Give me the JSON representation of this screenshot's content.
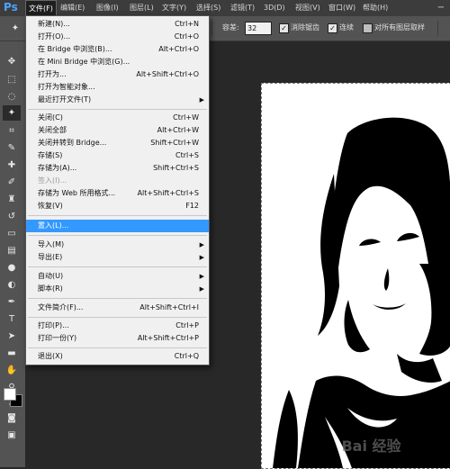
{
  "app": {
    "logo": "Ps"
  },
  "menubar": {
    "items": [
      {
        "label": "文件(F)"
      },
      {
        "label": "编辑(E)"
      },
      {
        "label": "图像(I)"
      },
      {
        "label": "图层(L)"
      },
      {
        "label": "文字(Y)"
      },
      {
        "label": "选择(S)"
      },
      {
        "label": "滤镜(T)"
      },
      {
        "label": "3D(D)"
      },
      {
        "label": "视图(V)"
      },
      {
        "label": "窗口(W)"
      },
      {
        "label": "帮助(H)"
      }
    ]
  },
  "options": {
    "tolerance_label": "容差:",
    "tolerance_value": "32",
    "antialias_label": "消除锯齿",
    "contiguous_label": "连续",
    "sample_all_label": "对所有图层取样"
  },
  "file_menu": {
    "items": [
      {
        "label": "新建(N)...",
        "shortcut": "Ctrl+N"
      },
      {
        "label": "打开(O)...",
        "shortcut": "Ctrl+O"
      },
      {
        "label": "在 Bridge 中浏览(B)...",
        "shortcut": "Alt+Ctrl+O"
      },
      {
        "label": "在 Mini Bridge 中浏览(G)...",
        "shortcut": ""
      },
      {
        "label": "打开为...",
        "shortcut": "Alt+Shift+Ctrl+O"
      },
      {
        "label": "打开为智能对象...",
        "shortcut": ""
      },
      {
        "label": "最近打开文件(T)",
        "shortcut": ""
      },
      {
        "label": "关闭(C)",
        "shortcut": "Ctrl+W"
      },
      {
        "label": "关闭全部",
        "shortcut": "Alt+Ctrl+W"
      },
      {
        "label": "关闭并转到 Bridge...",
        "shortcut": "Shift+Ctrl+W"
      },
      {
        "label": "存储(S)",
        "shortcut": "Ctrl+S"
      },
      {
        "label": "存储为(A)...",
        "shortcut": "Shift+Ctrl+S"
      },
      {
        "label": "签入(I)...",
        "shortcut": ""
      },
      {
        "label": "存储为 Web 所用格式...",
        "shortcut": "Alt+Shift+Ctrl+S"
      },
      {
        "label": "恢复(V)",
        "shortcut": "F12"
      },
      {
        "label": "置入(L)...",
        "shortcut": ""
      },
      {
        "label": "导入(M)",
        "shortcut": ""
      },
      {
        "label": "导出(E)",
        "shortcut": ""
      },
      {
        "label": "自动(U)",
        "shortcut": ""
      },
      {
        "label": "脚本(R)",
        "shortcut": ""
      },
      {
        "label": "文件简介(F)...",
        "shortcut": "Alt+Shift+Ctrl+I"
      },
      {
        "label": "打印(P)...",
        "shortcut": "Ctrl+P"
      },
      {
        "label": "打印一份(Y)",
        "shortcut": "Alt+Shift+Ctrl+P"
      },
      {
        "label": "退出(X)",
        "shortcut": "Ctrl+Q"
      }
    ]
  },
  "watermark": {
    "text": "Bai 经验"
  },
  "colors": {
    "highlight": "#3399ff",
    "menu_bg": "#f0f0f0",
    "ui_dark": "#535353"
  }
}
